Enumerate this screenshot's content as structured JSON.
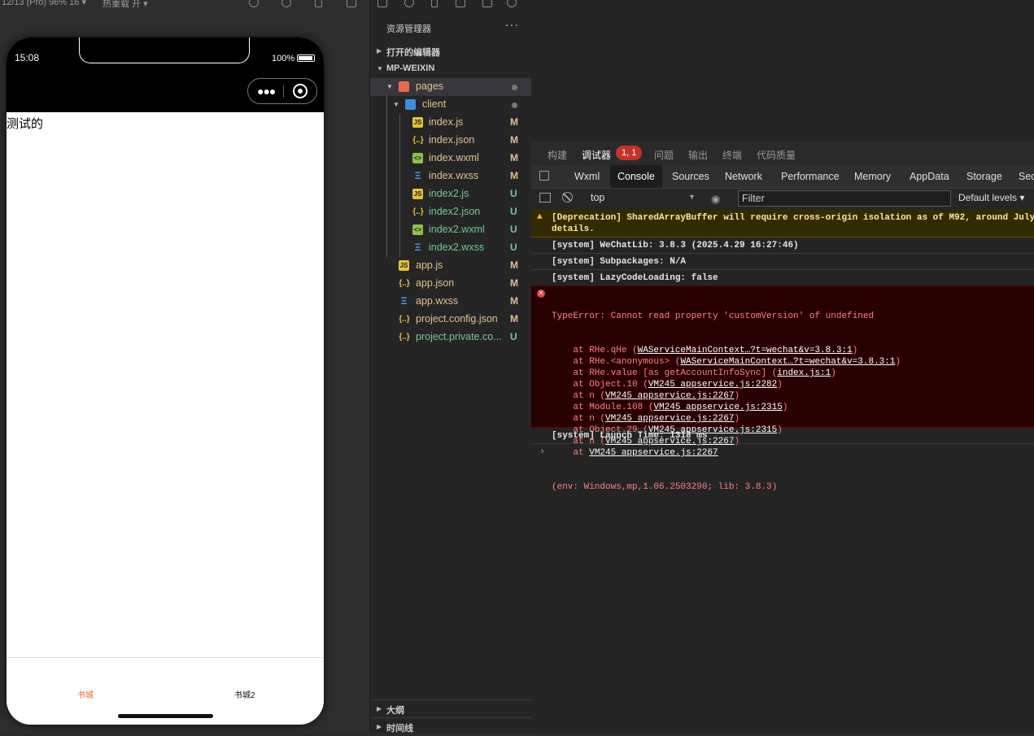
{
  "simulator": {
    "toolbar": {
      "device": "12/13 (Pro) 96% 16 ▾",
      "reload": "热重载 开 ▾"
    },
    "status_time": "15:08",
    "battery": "100%",
    "page_text": "测试的",
    "tabs": [
      {
        "label": "书城",
        "color": "#e86a2a"
      },
      {
        "label": "书城2",
        "color": "#111111"
      }
    ]
  },
  "explorer": {
    "title": "资源管理器",
    "more": "···",
    "open_editors": "打开的编辑器",
    "project": "MP-WEIXIN",
    "tree": [
      {
        "name": "pages",
        "status": "",
        "kind": "folder"
      },
      {
        "name": "client",
        "status": "",
        "kind": "folder"
      },
      {
        "name": "index.js",
        "status": "M",
        "kind": "js"
      },
      {
        "name": "index.json",
        "status": "M",
        "kind": "json"
      },
      {
        "name": "index.wxml",
        "status": "M",
        "kind": "wxml"
      },
      {
        "name": "index.wxss",
        "status": "M",
        "kind": "wxss"
      },
      {
        "name": "index2.js",
        "status": "U",
        "kind": "js"
      },
      {
        "name": "index2.json",
        "status": "U",
        "kind": "json"
      },
      {
        "name": "index2.wxml",
        "status": "U",
        "kind": "wxml"
      },
      {
        "name": "index2.wxss",
        "status": "U",
        "kind": "wxss"
      },
      {
        "name": "app.js",
        "status": "M",
        "kind": "js"
      },
      {
        "name": "app.json",
        "status": "M",
        "kind": "json"
      },
      {
        "name": "app.wxss",
        "status": "M",
        "kind": "wxss"
      },
      {
        "name": "project.config.json",
        "status": "M",
        "kind": "json"
      },
      {
        "name": "project.private.co...",
        "status": "U",
        "kind": "json"
      }
    ],
    "outline": "大纲",
    "timeline": "时间线"
  },
  "devtools": {
    "top_tabs": [
      "构建",
      "调试器",
      "问题",
      "输出",
      "终端",
      "代码质量"
    ],
    "badge": "1, 1",
    "panel_tabs": [
      "Wxml",
      "Console",
      "Sources",
      "Network",
      "Performance",
      "Memory",
      "AppData",
      "Storage",
      "Sec"
    ],
    "context": "top",
    "filter_placeholder": "Filter",
    "levels": "Default levels ▾",
    "console": {
      "warning": "[Deprecation] SharedArrayBuffer will require cross-origin isolation as of M92, around July\ndetails.",
      "system1": "[system] WeChatLib: 3.8.3 (2025.4.29 16:27:46)",
      "system2": "[system] Subpackages: N/A",
      "system3": "[system] LazyCodeLoading: false",
      "error_title": "TypeError: Cannot read property 'customVersion' of undefined",
      "stack": [
        {
          "pre": "    at RHe.qHe (",
          "link": "WAServiceMainContext…?t=wechat&v=3.8.3:1",
          "post": ")"
        },
        {
          "pre": "    at RHe.<anonymous> (",
          "link": "WAServiceMainContext…?t=wechat&v=3.8.3:1",
          "post": ")"
        },
        {
          "pre": "    at RHe.value [as getAccountInfoSync] (",
          "link": "index.js:1",
          "post": ")"
        },
        {
          "pre": "    at Object.10 (",
          "link": "VM245 appservice.js:2282",
          "post": ")"
        },
        {
          "pre": "    at n (",
          "link": "VM245 appservice.js:2267",
          "post": ")"
        },
        {
          "pre": "    at Module.108 (",
          "link": "VM245 appservice.js:2315",
          "post": ")"
        },
        {
          "pre": "    at n (",
          "link": "VM245 appservice.js:2267",
          "post": ")"
        },
        {
          "pre": "    at Object.29 (",
          "link": "VM245 appservice.js:2315",
          "post": ")"
        },
        {
          "pre": "    at n (",
          "link": "VM245 appservice.js:2267",
          "post": ")"
        },
        {
          "pre": "    at ",
          "link": "VM245 appservice.js:2267",
          "post": ""
        }
      ],
      "env": "(env: Windows,mp,1.06.2503290; lib: 3.8.3)",
      "launch": "[system] Launch Time: 1318 ms",
      "prompt": "›"
    }
  }
}
